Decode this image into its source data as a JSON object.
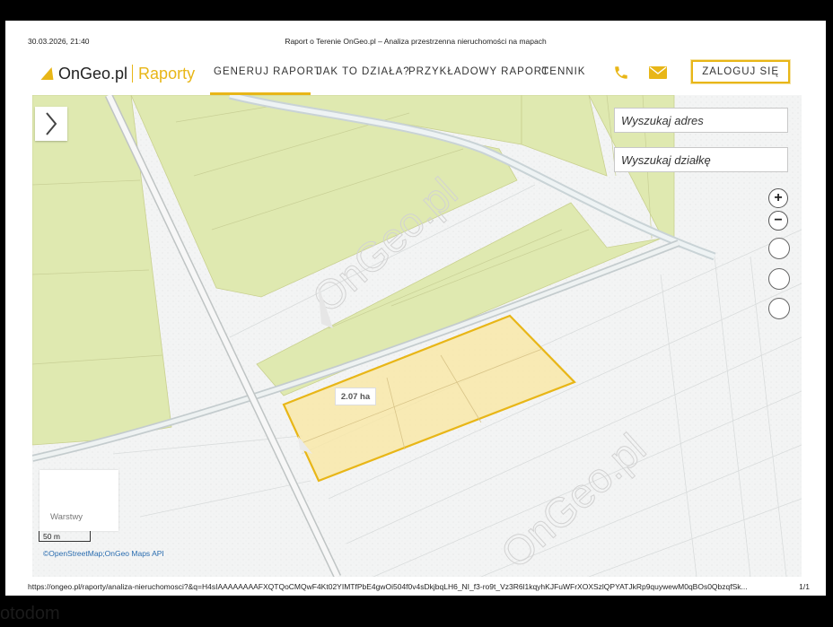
{
  "print": {
    "date": "30.03.2026, 21:40",
    "title": "Raport o Terenie OnGeo.pl – Analiza przestrzenna nieruchomości na mapach",
    "url": "https://ongeo.pl/raporty/analiza-nieruchomosci?&q=H4sIAAAAAAAAFXQTQoCMQwF4Kt02YIMTfPbE4gwOi504f0v4sDkjbqLH6_NI_f3-ro9t_Vz3R6l1kqyhKJFuWFrXOXSzlQPYATJkRp9quywewM0qBOs0QbzqfSk...",
    "page": "1/1"
  },
  "header": {
    "logo_name": "OnGeo.pl",
    "logo_sub": "Raporty",
    "nav": [
      "GENERUJ RAPORT",
      "JAK TO DZIAŁA?",
      "PRZYKŁADOWY RAPORT",
      "CENNIK"
    ],
    "login": "ZALOGUJ SIĘ",
    "accent": "#e8b617"
  },
  "map": {
    "search_address_placeholder": "Wyszukaj adres",
    "search_plot_placeholder": "Wyszukaj działkę",
    "zoom_in": "+",
    "zoom_out": "−",
    "area_label": "2.07 ha",
    "layers_label": "Warstwy",
    "scale_label": "50 m",
    "attribution": "©OpenStreetMap;OnGeo Maps API",
    "watermark": "OnGeo.pl",
    "parcel_fill": "#f8e7a8",
    "parcel_stroke": "#e8b617",
    "field_green": "#dfe9b0"
  },
  "footer_fragment": "otodom"
}
